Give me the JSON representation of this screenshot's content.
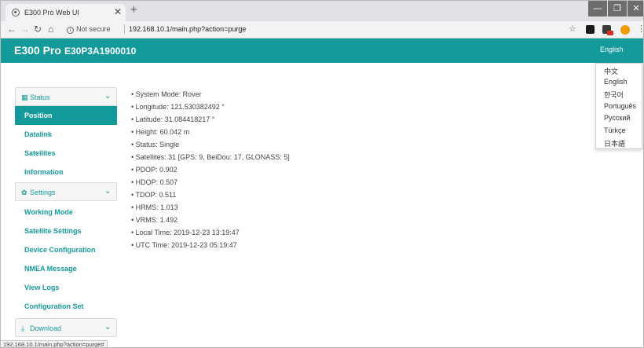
{
  "browser": {
    "tab_title": "E300 Pro Web UI",
    "tab_close": "✕",
    "new_tab": "+",
    "not_secure": "Not secure",
    "url": "192.168.10.1/main.php?action=purge",
    "status_url": "192.168.10.1/main.php?action=purge#"
  },
  "header": {
    "title": "E300 Pro",
    "serial": "E30P3A1900010",
    "language": "English"
  },
  "language_menu": [
    "中文",
    "English",
    "한국어",
    "Português",
    "Русский",
    "Türkçe",
    "日本語"
  ],
  "sidebar": {
    "status_label": "Status",
    "status_items": [
      "Position",
      "Datalink",
      "Satellites",
      "Information"
    ],
    "settings_label": "Settings",
    "settings_items": [
      "Working Mode",
      "Satellite Settings",
      "Device Configuration",
      "NMEA Message",
      "View Logs",
      "Configuration Set"
    ],
    "download_label": "Download",
    "active_item": "Position"
  },
  "info": [
    "• System Mode:  Rover",
    "• Longitude:  121.530382492 °",
    "• Latitude:  31.084418217 °",
    "• Height:  60.042 m",
    "• Status:  Single",
    "• Satellites:  31 [GPS: 9, BeiDou: 17, GLONASS: 5]",
    "• PDOP:  0.902",
    "• HDOP:  0.507",
    "• TDOP:  0.511",
    "• HRMS:  1.013",
    "• VRMS:  1.492",
    "• Local Time:  2019-12-23 13:19:47",
    "• UTC Time:  2019-12-23 05:19:47"
  ],
  "colors": {
    "accent": "#159a9c"
  }
}
